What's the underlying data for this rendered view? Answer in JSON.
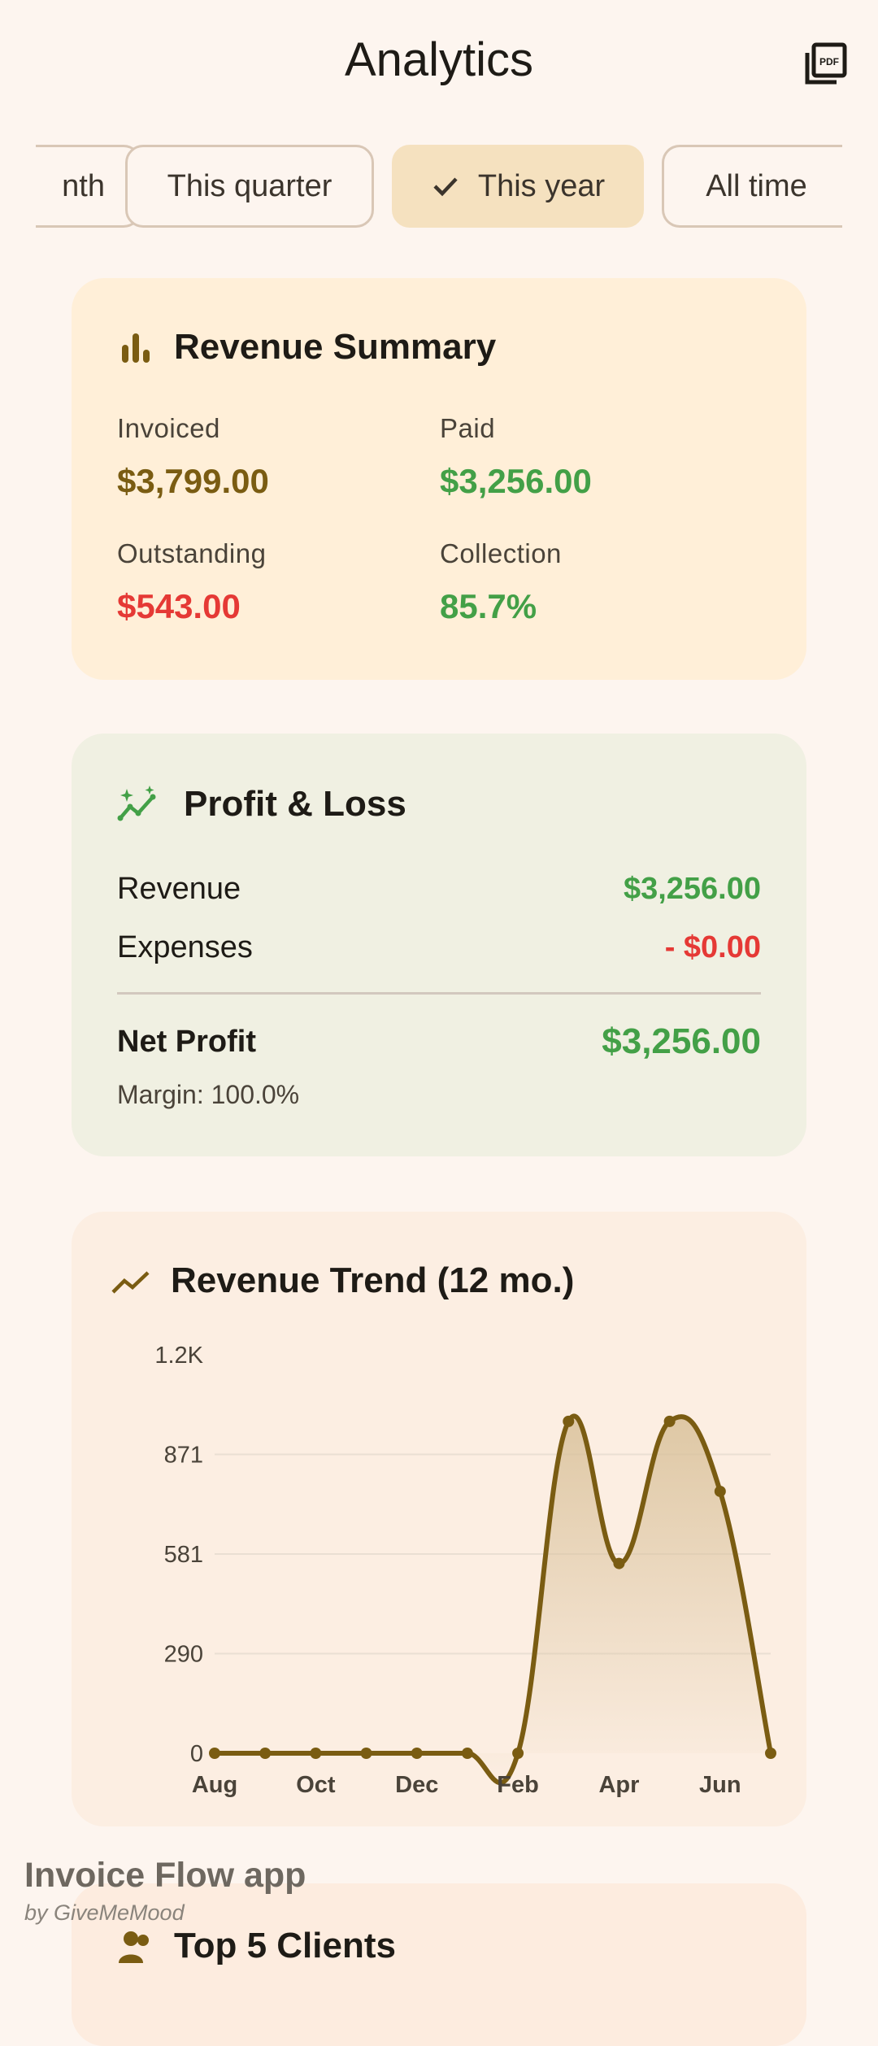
{
  "appbar": {
    "title": "Analytics",
    "pdf_icon": "pdf-export-icon"
  },
  "filters": {
    "chips": [
      {
        "label": "This month",
        "visible_text": "nth",
        "selected": false
      },
      {
        "label": "This quarter",
        "selected": false
      },
      {
        "label": "This year",
        "selected": true
      },
      {
        "label": "All time",
        "selected": false
      }
    ]
  },
  "revenue_summary": {
    "title": "Revenue Summary",
    "icon": "bar-chart-icon",
    "invoiced": {
      "label": "Invoiced",
      "value": "$3,799.00"
    },
    "paid": {
      "label": "Paid",
      "value": "$3,256.00"
    },
    "outstanding": {
      "label": "Outstanding",
      "value": "$543.00"
    },
    "collection": {
      "label": "Collection",
      "value": "85.7%"
    }
  },
  "profit_loss": {
    "title": "Profit & Loss",
    "icon": "sparkle-trend-icon",
    "revenue": {
      "label": "Revenue",
      "value": "$3,256.00"
    },
    "expenses": {
      "label": "Expenses",
      "value": "- $0.00"
    },
    "net_profit": {
      "label": "Net Profit",
      "value": "$3,256.00"
    },
    "margin": "Margin: 100.0%"
  },
  "revenue_trend": {
    "title": "Revenue Trend (12 mo.)",
    "icon": "trend-line-icon"
  },
  "chart_data": {
    "type": "area",
    "title": "Revenue Trend (12 mo.)",
    "x": [
      "Aug",
      "Sep",
      "Oct",
      "Nov",
      "Dec",
      "Jan",
      "Feb",
      "Mar",
      "Apr",
      "May",
      "Jun",
      "Jul"
    ],
    "tick_labels_x": [
      "Aug",
      "Oct",
      "Dec",
      "Feb",
      "Apr",
      "Jun"
    ],
    "tick_labels_y": [
      "0",
      "290",
      "581",
      "871",
      "1.2K"
    ],
    "series": [
      {
        "values": [
          0,
          0,
          0,
          0,
          0,
          0,
          0,
          967,
          553,
          967,
          763,
          0
        ]
      }
    ],
    "ylim": [
      0,
      1161
    ],
    "grid": true,
    "colors": {
      "line": "#7A5C12",
      "fill": "#D9C19A"
    }
  },
  "top_clients": {
    "title": "Top 5 Clients",
    "icon": "people-icon"
  },
  "watermark": {
    "title": "Invoice Flow app",
    "subtitle": "by GiveMeMood"
  },
  "colors": {
    "accent": "#7A5C12",
    "positive": "#43A047",
    "negative": "#E53935",
    "invoiced": "#7A5C12"
  }
}
